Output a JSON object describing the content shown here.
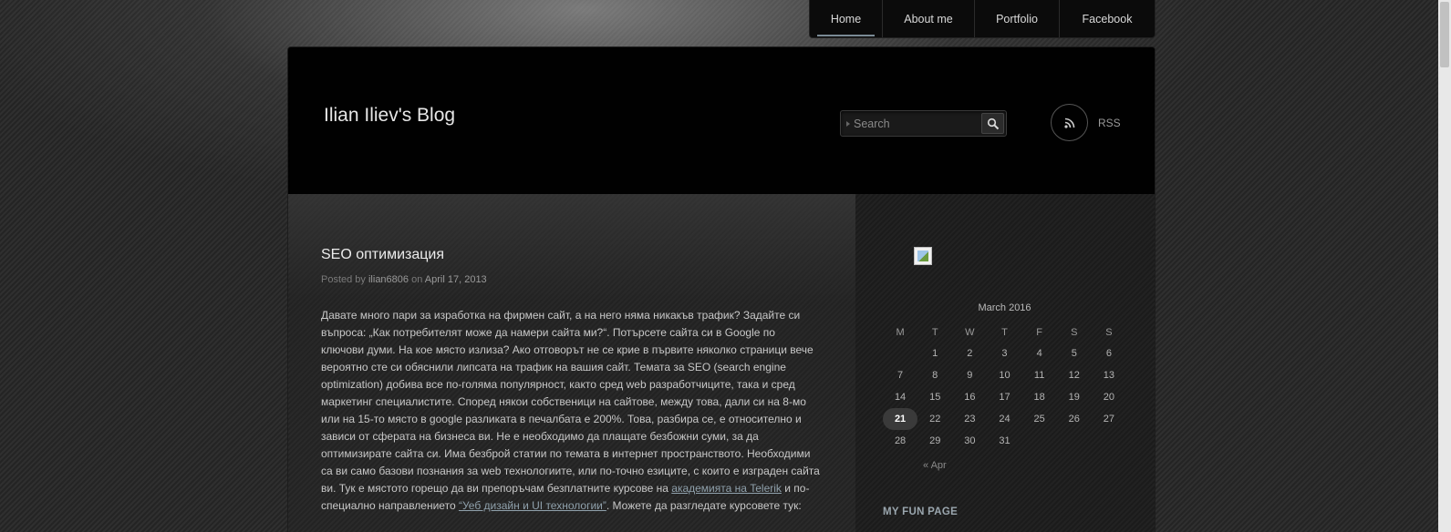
{
  "nav": {
    "items": [
      {
        "label": "Home",
        "active": true
      },
      {
        "label": "About me",
        "active": false
      },
      {
        "label": "Portfolio",
        "active": false
      },
      {
        "label": "Facebook",
        "active": false
      }
    ]
  },
  "header": {
    "site_title": "Ilian Iliev's Blog",
    "search_placeholder": "Search",
    "search_icon": "magnifier-icon",
    "rss_icon": "rss-icon",
    "rss_label": "RSS"
  },
  "post": {
    "title": "SEO оптимизация",
    "meta_prefix": "Posted by",
    "author": "ilian6806",
    "meta_on": "on",
    "date": "April 17, 2013",
    "body_part1": "Давате много пари за изработка на фирмен сайт, а на него няма никакъв трафик? Задайте си въпроса: „Как потребителят може да намери сайта ми?“. Потърсете сайта си в Google по ключови думи. На кое място излиза? Ако отговорът не се крие в първите няколко страници вече вероятно сте си обяснили липсата на трафик на вашия сайт. Темата за SEO (search engine optimization) добива все по-голяма популярност, както сред web разработчиците, така и сред маркетинг специалистите. Според някои собственици на сайтове, между това, дали си на 8-мо или на 15-то място в google разликата в печалбата е 200%. Това, разбира се, е относително и зависи от сферата на бизнеса ви. Не е необходимо да плащате безбожни суми, за да оптимизирате сайта си. Има безброй статии по темата в интернет пространството. Необходими са ви само базови познания за web технологиите, или по-точно езиците, с които е изграден сайта ви. Тук е мястото горещо да ви препоръчам безплатните курсове на ",
    "link1": "академията на Telerik",
    "body_part2": " и по-специално направлението ",
    "link2": "“Уеб дизайн и UI технологии”",
    "body_part3": ". Можете да разгледате курсовете тук:"
  },
  "sidebar": {
    "image_icon": "broken-image-icon",
    "calendar": {
      "caption": "March 2016",
      "weekdays": [
        "M",
        "T",
        "W",
        "T",
        "F",
        "S",
        "S"
      ],
      "weeks": [
        [
          "",
          "1",
          "2",
          "3",
          "4",
          "5",
          "6"
        ],
        [
          "7",
          "8",
          "9",
          "10",
          "11",
          "12",
          "13"
        ],
        [
          "14",
          "15",
          "16",
          "17",
          "18",
          "19",
          "20"
        ],
        [
          "21",
          "22",
          "23",
          "24",
          "25",
          "26",
          "27"
        ],
        [
          "28",
          "29",
          "30",
          "31",
          "",
          "",
          ""
        ]
      ],
      "today": "21",
      "prev_link": "« Apr"
    },
    "widget_title": "MY FUN PAGE"
  },
  "colors": {
    "background": "#2a2a2a",
    "header": "#010101",
    "link": "#8fa0ab",
    "nav_active_underline": "#7a8a95"
  }
}
